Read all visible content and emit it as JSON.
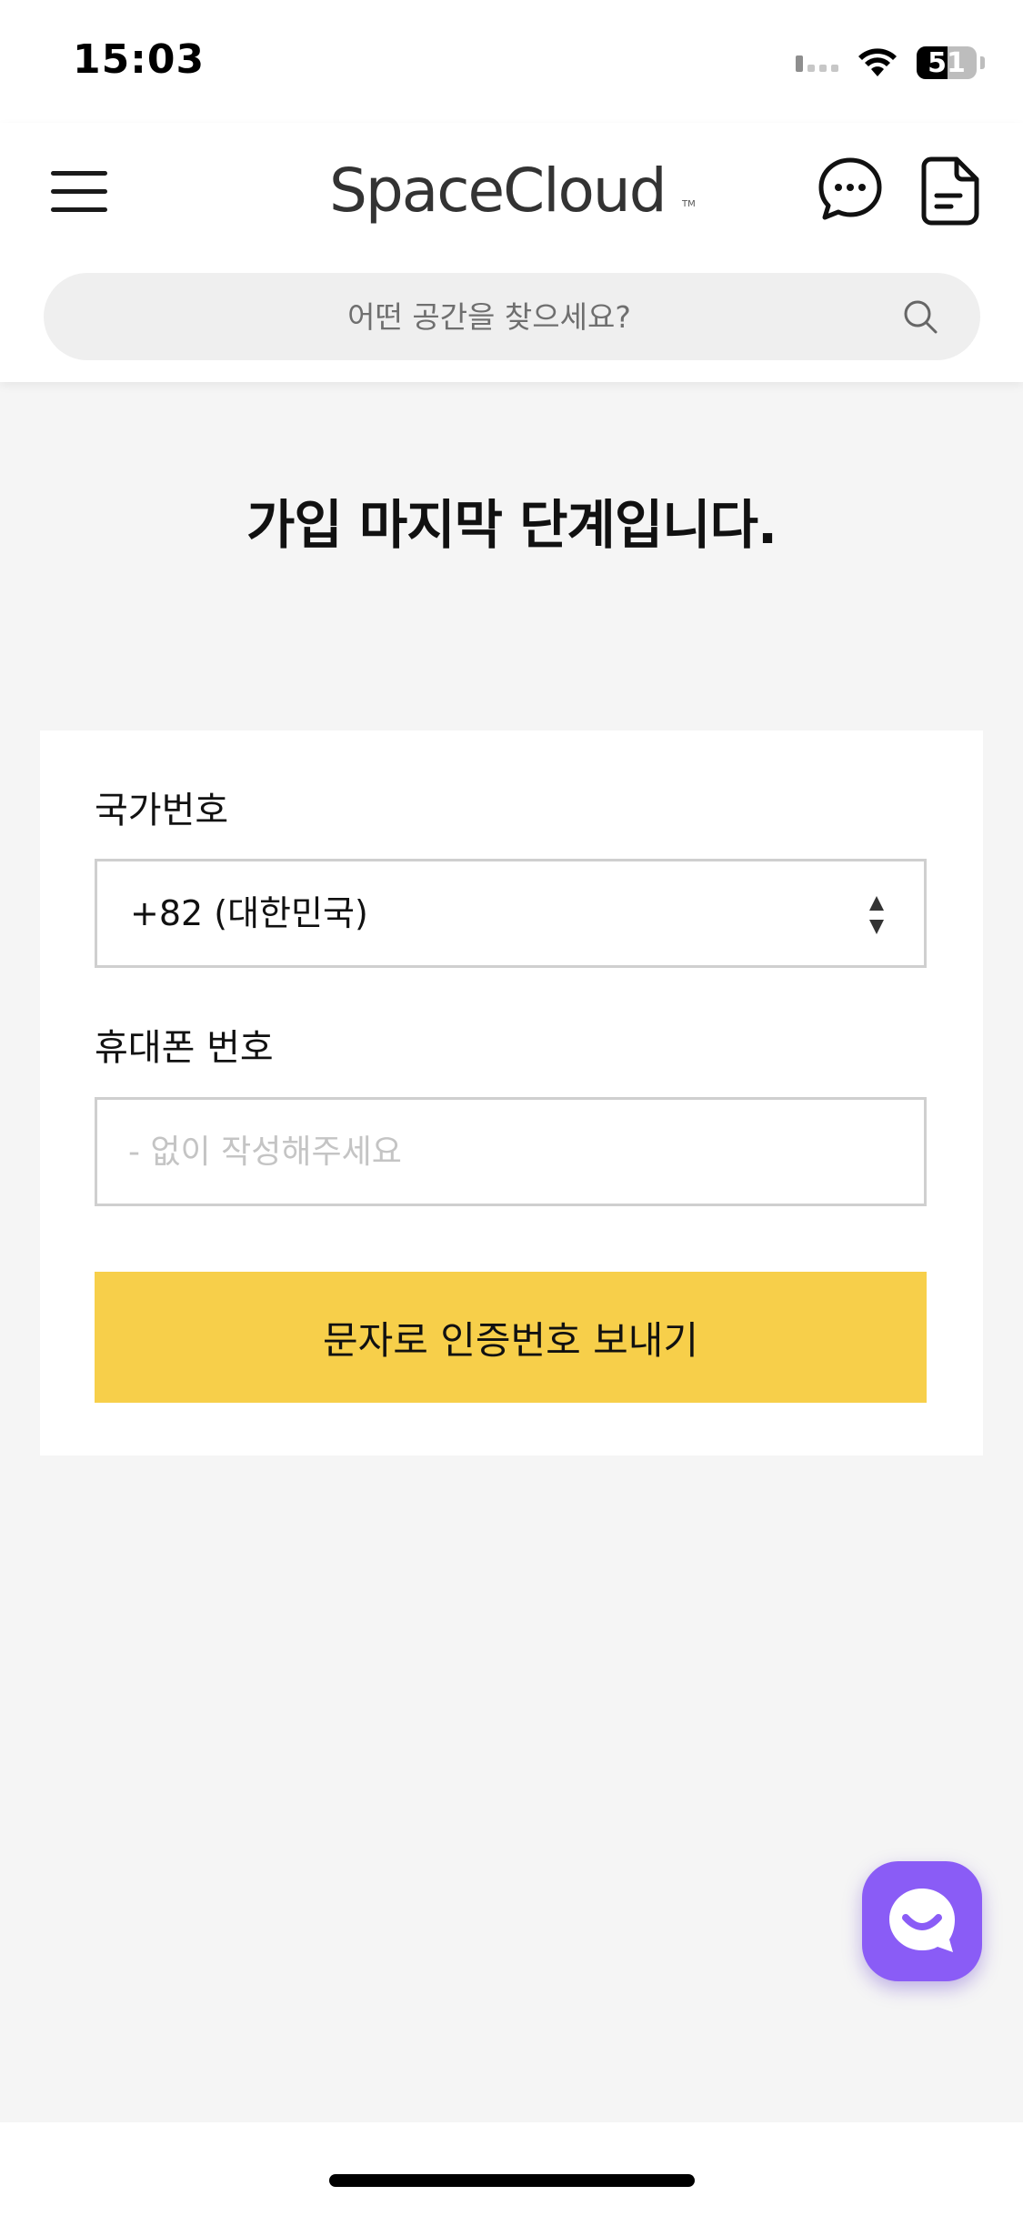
{
  "status_bar": {
    "time": "15:03",
    "battery_percent": 51,
    "battery_label": "51"
  },
  "header": {
    "logo": "SpaceCloud",
    "logo_tm": "TM",
    "menu_icon": "hamburger-menu-icon",
    "chat_icon": "chat-bubble-icon",
    "doc_icon": "document-icon"
  },
  "search": {
    "placeholder": "어떤 공간을 찾으세요?",
    "value": ""
  },
  "main": {
    "title": "가입 마지막 단계입니다."
  },
  "form": {
    "country_label": "국가번호",
    "country_value": "+82 (대한민국)",
    "phone_label": "휴대폰 번호",
    "phone_placeholder": "- 없이 작성해주세요",
    "phone_value": "",
    "submit_label": "문자로 인증번호 보내기"
  },
  "colors": {
    "accent_yellow": "#f7cf4a",
    "chat_purple": "#8a5cf6",
    "background": "#f5f5f5"
  },
  "floating": {
    "icon": "chat-support-icon"
  }
}
